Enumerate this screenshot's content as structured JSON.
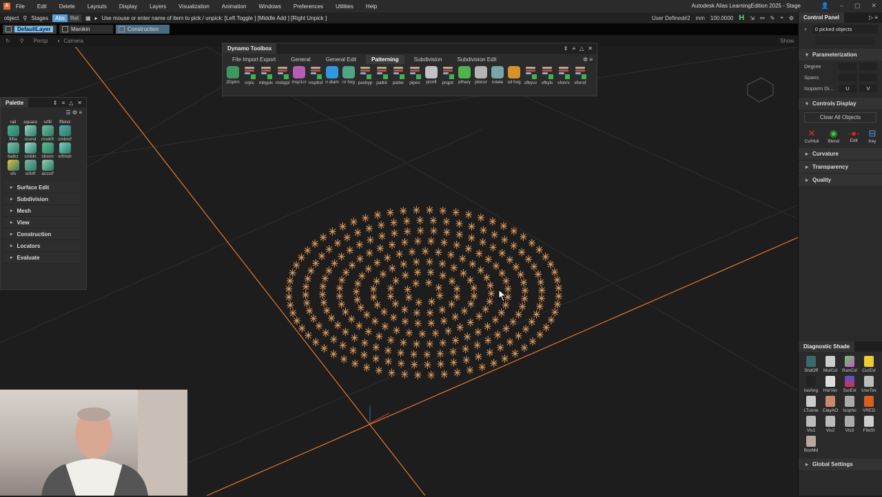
{
  "menubar": {
    "logo": "A",
    "items": [
      "File",
      "Edit",
      "Delete",
      "Layouts",
      "Display",
      "Layers",
      "Visualization",
      "Animation",
      "Windows",
      "Preferences",
      "Utilities",
      "Help"
    ],
    "title": "Autodesk Alias LearningEdition 2025  - Stage"
  },
  "toolbar": {
    "object": "object",
    "stages": "Stages",
    "abs": "Abs",
    "rel": "Rel",
    "prompt": "Use mouse or enter name of item to pick / unpick: [Left Toggle ] [Middle Add ] [Right Unpick ]",
    "construction_plane": "User Defined#2",
    "units": "mm",
    "tolerance": "100.0000",
    "h": "H"
  },
  "layers": [
    "DefaultLayer",
    "Manikin",
    "Construction"
  ],
  "viewport": {
    "view": "Persp",
    "camera": "Camera",
    "show": "Show"
  },
  "dynamo": {
    "title": "Dynamo Toolbox",
    "tabs": [
      "File Import Export",
      "General",
      "General Edit",
      "Patterning",
      "Subdivision",
      "Subdivision Edit"
    ],
    "active_tab": "Patterning",
    "tools": [
      "2Dptrn",
      "crpic",
      "mbypic",
      "msbypi",
      "msp1cr",
      "mspbsf",
      "n diam",
      "nr hxg",
      "pasbyp",
      "patkit",
      "patter",
      "pipes",
      "plcnfl",
      "prqptr",
      "pthary",
      "ptoncr",
      "rotate",
      "sd hxg",
      "sfbycv",
      "sfbyls",
      "sfonrv",
      "sfonsf"
    ]
  },
  "palette": {
    "title": "Palette",
    "top_row": [
      "rail",
      "square",
      "srfill",
      "ffblnd"
    ],
    "tools": [
      "filfla",
      "round",
      "msdrft",
      "cmbsrf",
      "ballcr",
      "cmbln",
      "stnsm",
      "srfmsh",
      "sfs",
      "srfoff",
      "accsrf"
    ],
    "sections": [
      "Surface Edit",
      "Subdivision",
      "Mesh",
      "View",
      "Construction",
      "Locators",
      "Evaluate"
    ]
  },
  "control_panel": {
    "title": "Control Panel",
    "picked": "0 picked objects",
    "parameterization": "Parameterization",
    "degree": "Degree",
    "spans": "Spans",
    "isoparm": "Isoparm Di...",
    "u": "U",
    "v": "V",
    "controls_display": "Controls Display",
    "clear_all": "Clear All Objects",
    "controls": [
      "Cv/Hull",
      "Blend",
      "Edit",
      "Key"
    ],
    "sections": [
      "Curvature",
      "Transparency",
      "Quality"
    ]
  },
  "diagnostic": {
    "title": "Diagnostic Shade",
    "items": [
      "ShdOff",
      "MulCol",
      "RanCol",
      "CurEvl",
      "IsoAng",
      "HorVer",
      "SurEvl",
      "UseTex",
      "LTunne",
      "ClayAO",
      "Isopho",
      "VRED",
      "Vis1",
      "Vis2",
      "Vis3",
      "FileSt",
      "BoxMd"
    ],
    "global": "Global Settings"
  },
  "colors": {
    "accent": "#5aa0d8",
    "axis": "#e8782a",
    "pattern": "#e09a5a"
  }
}
